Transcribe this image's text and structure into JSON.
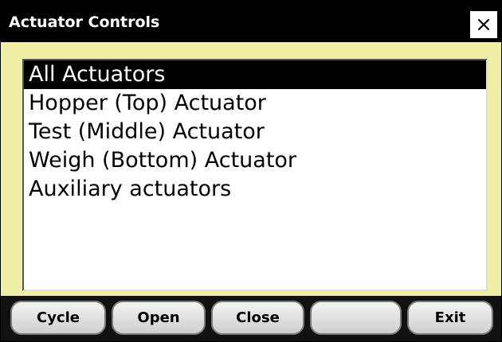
{
  "window": {
    "title": "Actuator Controls",
    "close_glyph": "×"
  },
  "list": {
    "items": [
      {
        "label": "All Actuators",
        "selected": true
      },
      {
        "label": "Hopper (Top) Actuator",
        "selected": false
      },
      {
        "label": "Test (Middle) Actuator",
        "selected": false
      },
      {
        "label": "Weigh (Bottom) Actuator",
        "selected": false
      },
      {
        "label": "Auxiliary actuators",
        "selected": false
      }
    ]
  },
  "buttons": {
    "cycle": "Cycle",
    "open": "Open",
    "close": "Close",
    "blank": "",
    "exit": "Exit"
  },
  "colors": {
    "title_bar": "#000000",
    "window_background": "#eeeea4",
    "selection": "#000000"
  }
}
